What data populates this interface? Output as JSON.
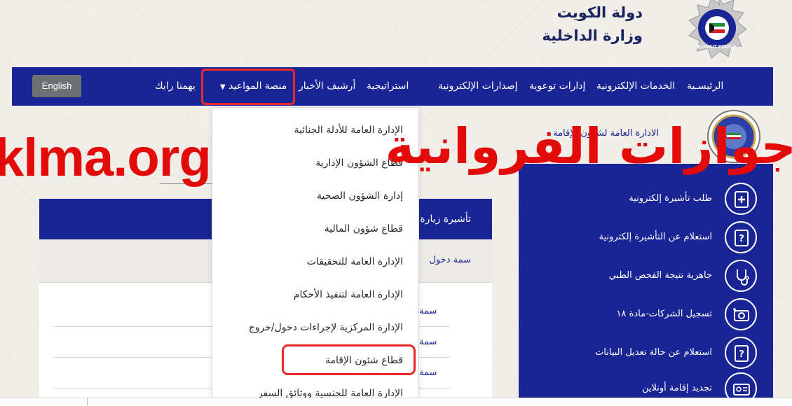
{
  "header": {
    "title_line1": "دولة الكويت",
    "title_line2": "وزارة الداخلية",
    "logo_text": "KUWAIT POLICE"
  },
  "navbar": {
    "items": [
      {
        "label": "الرئيسـية"
      },
      {
        "label": "الخدمات الإلكترونية"
      },
      {
        "label": "إدارات توعوية"
      },
      {
        "label": "إصدارات الإلكترونية"
      },
      {
        "label": "استراتيجية"
      },
      {
        "label": "أرشيف الأخبار"
      },
      {
        "label": "منصة المواعيد"
      },
      {
        "label": "يهمنا رايك"
      }
    ],
    "english_button": "English"
  },
  "dropdown": {
    "items": [
      "الإدارة العامة للأدلة الجنائية",
      "قطاع الشؤون الإدارية",
      "إدارة الشؤون الصحية",
      "قطاع شؤون المالية",
      "الإدارة العامة للتحقيقات",
      "الإدارة العامة لتنفيذ الأحكام",
      "الإدارة المركزية لإجراءات دخول/خروج",
      "قطاع شئون الإقامة",
      "الإدارة العامة للجنسية ووثائق السفر"
    ]
  },
  "content": {
    "tab_label": "تأشيرة زيارة",
    "subtab_label": "سمة دخول",
    "rows": [
      "سمة",
      "سمة",
      "سمة"
    ]
  },
  "sidebar": {
    "header_text": "الادارة العامة لشؤون الإقامة",
    "items": [
      {
        "label": "طلب تأشيرة إلكترونية",
        "icon": "document-plus-icon"
      },
      {
        "label": "استعلام عن التأشيرة إلكترونية",
        "icon": "document-question-icon"
      },
      {
        "label": "جاهزية نتيجة الفحص الطبي",
        "icon": "stethoscope-icon"
      },
      {
        "label": "تسجيل الشركات-مادة ١٨",
        "icon": "camera-plus-icon"
      },
      {
        "label": "استعلام عن حالة تعديل البيانات",
        "icon": "document-question-icon"
      },
      {
        "label": "تجديد إقامة أونلاين",
        "icon": "id-card-icon"
      }
    ]
  },
  "watermark": {
    "left_text": "klma.org",
    "right_text": "جوازات الفروانية"
  },
  "colors": {
    "nav_blue": "#1a2595",
    "highlight_red": "#e62828",
    "watermark_red": "#e30a0a",
    "background": "#f1eee9"
  }
}
